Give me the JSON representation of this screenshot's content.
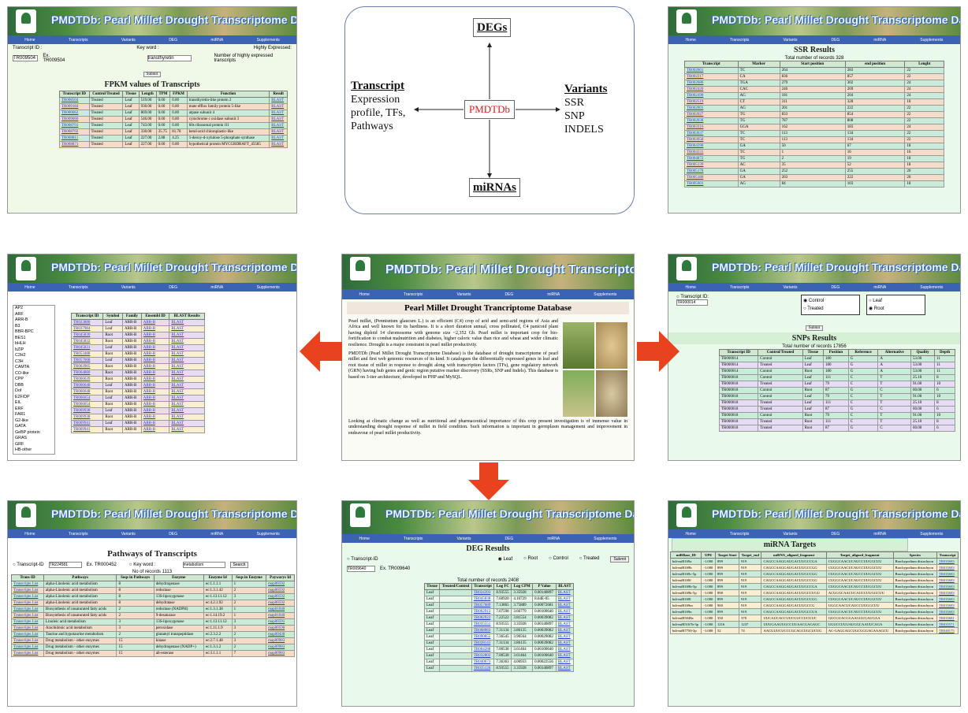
{
  "banner_title": "PMDTDb: Pearl Millet Drought Transcriptome Database",
  "nav": [
    "Home",
    "Transcripts",
    "Variants",
    "DEG",
    "miRNA",
    "Supplements"
  ],
  "diagram": {
    "center": "PMDTDb",
    "top": "DEGs",
    "bottom": "miRNAs",
    "left_title": "Transcript",
    "left_body": [
      "Expression",
      "profile, TFs,",
      "Pathways"
    ],
    "right_title": "Variants",
    "right_body": [
      "SSR",
      "SNP",
      "INDELS"
    ]
  },
  "fpkm": {
    "heading": "FPKM values of Transcripts",
    "form": {
      "tid_label": "Transcript ID :",
      "tid_value": "TR009504",
      "tid_example": "Ex. TR009504",
      "kw_label": "Key word :",
      "kw_value": "transthyretin",
      "hi_label": "Highly Expressed:",
      "submit": "Submit",
      "hi_note": "Number of highly expressed transcripts"
    },
    "headers": [
      "Transcript ID",
      "Control/Treated",
      "Tissue",
      "Length",
      "TPM",
      "FPKM",
      "Function",
      "Result"
    ],
    "rows": [
      [
        "TR008504",
        "Treated",
        "Leaf",
        "519.00",
        "0.00",
        "0.00",
        "transthyretin-like protein 2",
        "BLAST"
      ],
      [
        "TR009184",
        "Treated",
        "Leaf",
        "930.00",
        "0.00",
        "0.00",
        "mate efflux family protein 5-like",
        "BLAST"
      ],
      [
        "TR000662",
        "Treated",
        "Leaf",
        "869.00",
        "0.00",
        "0.00",
        "atpase subunit 4",
        "BLAST"
      ],
      [
        "TR009660",
        "Treated",
        "Leaf",
        "546.00",
        "0.00",
        "0.00",
        "cytochrome c oxidase subunit 3",
        "BLAST"
      ],
      [
        "TR008701",
        "Treated",
        "Leaf",
        "743.00",
        "0.00",
        "0.00",
        "60s ribosomal protein l11",
        "BLAST"
      ],
      [
        "TR008702",
        "Treated",
        "Leaf",
        "330.00",
        "35.75",
        "81.78",
        "ketol-acid chloroplastic-like",
        "BLAST"
      ],
      [
        "TR008811",
        "Treated",
        "Leaf",
        "227.00",
        "2.88",
        "4.25",
        "1-deoxy-d-xylulose 5-phosphate synthase",
        "BLAST"
      ],
      [
        "TR008871",
        "Treated",
        "Leaf",
        "227.00",
        "0.00",
        "0.00",
        "hypothetical protein MYCGRDRAFT_45585",
        "BLAST"
      ]
    ]
  },
  "ssr": {
    "heading": "SSR Results",
    "total": "Total number of records 328",
    "headers": [
      "Transcript",
      "Marker",
      "Start position",
      "end position",
      "Lenght"
    ],
    "rows": [
      [
        "TR002601",
        "TC",
        "264",
        "283",
        "22"
      ],
      [
        "TR002217",
        "CA",
        "836",
        "857",
        "22"
      ],
      [
        "TR002686",
        "TGA",
        "279",
        "302",
        "24"
      ],
      [
        "TR002420",
        "CAC",
        "246",
        "269",
        "24"
      ],
      [
        "TR002490",
        "AG",
        "181",
        "204",
        "24"
      ],
      [
        "TR002519",
        "CT",
        "311",
        "328",
        "18"
      ],
      [
        "TR002001",
        "AG",
        "201",
        "222",
        "22"
      ],
      [
        "TR002027",
        "TG",
        "833",
        "854",
        "22"
      ],
      [
        "TR002038",
        "TG",
        "787",
        "808",
        "22"
      ],
      [
        "TR003316",
        "GGA",
        "162",
        "183",
        "24"
      ],
      [
        "TR003637",
        "TC",
        "113",
        "134",
        "22"
      ],
      [
        "TR003658",
        "TC",
        "113",
        "134",
        "22"
      ],
      [
        "TR004390",
        "GA",
        "50",
        "67",
        "18"
      ],
      [
        "TR004331",
        "TC",
        "1",
        "16",
        "16"
      ],
      [
        "TR004872",
        "TG",
        "2",
        "19",
        "18"
      ],
      [
        "TR005139",
        "AC",
        "35",
        "52",
        "18"
      ],
      [
        "TR005178",
        "GA",
        "252",
        "255",
        "20"
      ],
      [
        "TR005180",
        "GA",
        "203",
        "222",
        "20"
      ],
      [
        "TR005601",
        "AG",
        "84",
        "103",
        "18"
      ]
    ]
  },
  "tf": {
    "list": [
      "AP2",
      "ARF",
      "ARR-B",
      "B3",
      "BBR-BPC",
      "BES1",
      "bHLH",
      "bZIP",
      "C2H2",
      "C3H",
      "CAMTA",
      "CO-like",
      "CPP",
      "DBB",
      "Dof",
      "E2F/DP",
      "EIL",
      "ERF",
      "FAR1",
      "G2-like",
      "GATA",
      "GeBP protein",
      "GRAS",
      "GRF",
      "HB-other"
    ],
    "headers": [
      "Transcript ID",
      "Symbol",
      "Family",
      "Ensembl ID",
      "BLAST Results"
    ],
    "rows": [
      [
        "TR023880",
        "Leaf",
        "ARR-B",
        "ARR-B",
        "BLAST"
      ],
      [
        "TR037984",
        "Leaf",
        "ARR-B",
        "ARR-B",
        "BLAST"
      ],
      [
        "TR045830",
        "Root",
        "ARR-B",
        "ARR-B",
        "BLAST"
      ],
      [
        "TR045832",
        "Root",
        "ARR-B",
        "ARR-B",
        "BLAST"
      ],
      [
        "TR045831",
        "Leaf",
        "ARR-B",
        "ARR-B",
        "BLAST"
      ],
      [
        "TR053488",
        "Root",
        "ARR-B",
        "ARR-B",
        "BLAST"
      ],
      [
        "TR057668",
        "Leaf",
        "ARR-B",
        "ARR-B",
        "BLAST"
      ],
      [
        "TR063905",
        "Root",
        "ARR-B",
        "ARR-B",
        "BLAST"
      ],
      [
        "TR064880",
        "Root",
        "ARR-B",
        "ARR-B",
        "BLAST"
      ],
      [
        "TR066639",
        "Root",
        "ARR-B",
        "ARR-B",
        "BLAST"
      ],
      [
        "TR066648",
        "Leaf",
        "ARR-B",
        "ARR-B",
        "BLAST"
      ],
      [
        "TR066648",
        "Root",
        "ARR-B",
        "ARR-B",
        "BLAST"
      ],
      [
        "TR066654",
        "Leaf",
        "ARR-B",
        "ARR-B",
        "BLAST"
      ],
      [
        "TR066654",
        "Root",
        "ARR-B",
        "ARR-B",
        "BLAST"
      ],
      [
        "TR069938",
        "Leaf",
        "ARR-B",
        "ARR-B",
        "BLAST"
      ],
      [
        "TR069938",
        "Root",
        "ARR-B",
        "ARR-B",
        "BLAST"
      ],
      [
        "TR069941",
        "Leaf",
        "ARR-B",
        "ARR-B",
        "BLAST"
      ],
      [
        "TR069941",
        "Root",
        "ARR-B",
        "ARR-B",
        "BLAST"
      ]
    ]
  },
  "home": {
    "heading": "Pearl Millet Drought Trancriptome Database",
    "p1": "Pearl millet, (Pennisetum glaucum L.) is an efficient (C4) crop of arid and semi-arid regions of Asia and Africa and well known for its hardiness. It is a short duration annual, cross pollinated, C4 panicoid plant having diploid 14 chromosome with genome size ~2,352 Gb. Pearl millet is important crop for bio-fortification to combat malnutrition and diabetes, higher caloric value than rice and wheat and wider climatic resilience. Drought is a major constraint in pearl millet productivity.",
    "p2": "PMDTDb (Pearl Millet Drought Transcriptome Database) is the database of drought transcriptome of pearl millet and first web genomic resources of its kind. It catalogues the differentially expressed genes in leaf and root tissue of millet in response to drought along with transcription factors (TFs), gene regulatory network (GRN) having hub genes and genic region putative marker discovery (SSRs, SNP and Indels). This database is based on 3-tier architecture, developed in PHP and MySQL.",
    "p3": "Looking at climatic change as well as nutritional and pharmaceutical importance of this crop present investigation is of immense value in understanding drought response of millet in field condition. Such information is important in germplasm management and improvement in endeavour of pearl millet productivity."
  },
  "snp": {
    "heading": "SNPs Results",
    "tid_label": "Transcript ID:",
    "tid_value": "TR000014",
    "opts": [
      "Control",
      "Treated",
      "Leaf",
      "Root"
    ],
    "submit": "Submit",
    "total": "Total number of records 17856",
    "headers": [
      "Transcript ID",
      "Control/Treated",
      "Tissue",
      "Position",
      "Reference",
      "Alternative",
      "Quality",
      "Depth"
    ],
    "rows": [
      [
        "TR000014",
        "Control",
        "Leaf",
        "180",
        "G",
        "A",
        "53.00",
        "11"
      ],
      [
        "TR000014",
        "Treated",
        "Leaf",
        "180",
        "G",
        "A",
        "53.00",
        "11"
      ],
      [
        "TR000014",
        "Control",
        "Root",
        "180",
        "G",
        "A",
        "53.00",
        "11"
      ],
      [
        "TR000018",
        "Control",
        "Leaf",
        "111",
        "C",
        "T",
        "25.10",
        "8"
      ],
      [
        "TR000018",
        "Treated",
        "Leaf",
        "79",
        "C",
        "T",
        "91.00",
        "10"
      ],
      [
        "TR000018",
        "Control",
        "Root",
        "87",
        "G",
        "C",
        "60.00",
        "6"
      ],
      [
        "TR000018",
        "Control",
        "Leaf",
        "79",
        "C",
        "T",
        "91.00",
        "10"
      ],
      [
        "TR000018",
        "Treated",
        "Leaf",
        "111",
        "C",
        "T",
        "25.10",
        "8"
      ],
      [
        "TR000018",
        "Treated",
        "Leaf",
        "87",
        "G",
        "C",
        "60.00",
        "6"
      ],
      [
        "TR000018",
        "Control",
        "Root",
        "79",
        "C",
        "T",
        "91.00",
        "10"
      ],
      [
        "TR000018",
        "Treated",
        "Root",
        "111",
        "C",
        "T",
        "25.10",
        "8"
      ],
      [
        "TR000018",
        "Treated",
        "Root",
        "87",
        "G",
        "C",
        "60.00",
        "6"
      ]
    ]
  },
  "pathways": {
    "heading": "Pathways of Transcripts",
    "tid_label": "Transcript-ID",
    "tid_value": "TR224581",
    "tid_example": "Ex. TR000452",
    "kw_label": "Key word :",
    "kw_value": "metabolism",
    "search": "Search",
    "total": "No of records 1113",
    "headers": [
      "Trans ID",
      "Pathways",
      "Seqs in Pathways",
      "Enzyme",
      "Enzyme Id",
      "Seqs in Enzyme",
      "Paywarys Id"
    ],
    "rows": [
      [
        "Transcripts List",
        "alpha-Linolenic acid metabolism",
        "8",
        "dehydrogenase",
        "ec:1.1.1.1",
        "1",
        "map00592"
      ],
      [
        "Transcripts List",
        "alpha-Linolenic acid metabolism",
        "8",
        "reductase",
        "ec:1.3.1.42",
        "2",
        "map00592"
      ],
      [
        "Transcripts List",
        "alpha-Linolenic acid metabolism",
        "8",
        "13S-lipoxygenase",
        "ec:1.13.11.12",
        "3",
        "map00592"
      ],
      [
        "Transcripts List",
        "alpha-Linolenic acid metabolism",
        "8",
        "dehydratase",
        "ec:4.2.1.92",
        "2",
        "map00592"
      ],
      [
        "Transcripts List",
        "Biosynthesis of unsaturated fatty acids",
        "2",
        "reductase (NADPH)",
        "ec:1.3.1.38",
        "1",
        "map01040"
      ],
      [
        "Transcripts List",
        "Biosynthesis of unsaturated fatty acids",
        "2",
        "9-desaturase",
        "ec:1.14.19.2",
        "1",
        "map01040"
      ],
      [
        "Transcripts List",
        "Linoleic acid metabolism",
        "3",
        "13S-lipoxygenase",
        "ec:1.13.11.12",
        "3",
        "map00591"
      ],
      [
        "Transcripts List",
        "Arachidonic acid metabolism",
        "3",
        "peroxidase",
        "ec:1.11.1.9",
        "3",
        "map00590"
      ],
      [
        "Transcripts List",
        "Taurine and hypotaurine metabolism",
        "2",
        "glutamyl transpeptidase",
        "ec:2.3.2.2",
        "2",
        "map00430"
      ],
      [
        "Transcripts List",
        "Drug metabolism - other enzymes",
        "15",
        "kinase",
        "ec:2.7.1.48",
        "3",
        "map00983"
      ],
      [
        "Transcripts List",
        "Drug metabolism - other enzymes",
        "15",
        "dehydrogenase (NADP+)",
        "ec:1.3.1.2",
        "2",
        "map00983"
      ],
      [
        "Transcripts List",
        "Drug metabolism - other enzymes",
        "15",
        "ali-esterase",
        "ec:3.1.1.1",
        "7",
        "map00983"
      ]
    ]
  },
  "deg": {
    "heading": "DEG Results",
    "tid_label": "Transcript-ID",
    "tid_value": "TR009640",
    "tid_example": "Ex. TR009640",
    "opts": [
      "Leaf",
      "Root",
      "Control",
      "Treated"
    ],
    "submit": "Submit",
    "total": "Total number of records 2408",
    "headers": [
      "Tissue",
      "Treated/Control",
      "Transcript",
      "Log FC",
      "Log CPM",
      "P Value",
      "BLAST"
    ],
    "rows": [
      [
        "Leaf",
        "",
        "TR024393",
        "8.93555",
        "3.35928",
        "0.00140897",
        "BLAST"
      ],
      [
        "Leaf",
        "",
        "TR045838",
        "7.60920",
        "4.10729",
        "8.64E-05",
        "BLAST"
      ],
      [
        "Leaf",
        "",
        "TR057689",
        "7.13865",
        "3.75889",
        "0.00072681",
        "BLAST"
      ],
      [
        "Leaf",
        "",
        "TR062913",
        "7.07598",
        "3.66779",
        "0.00100640",
        "BLAST"
      ],
      [
        "Leaf",
        "",
        "TR062922",
        "7.22522",
        "3.81554",
        "0.00039082",
        "BLAST"
      ],
      [
        "Leaf",
        "",
        "TR035551",
        "8.93555",
        "3.35928",
        "0.00140897",
        "BLAST"
      ],
      [
        "Leaf",
        "",
        "TR068083",
        "7.31134",
        "3.86135",
        "0.00039082",
        "BLAST"
      ],
      [
        "Leaf",
        "",
        "TR090855",
        "7.36545",
        "3.90564",
        "0.00029082",
        "BLAST"
      ],
      [
        "Leaf",
        "",
        "TR028143",
        "7.31134",
        "3.86135",
        "0.00039082",
        "BLAST"
      ],
      [
        "Leaf",
        "",
        "TR064288",
        "7.00538",
        "3.61464",
        "0.00100640",
        "BLAST"
      ],
      [
        "Leaf",
        "",
        "TR032803",
        "7.00538",
        "3.61464",
        "0.00100640",
        "BLAST"
      ],
      [
        "Leaf",
        "",
        "TR040673",
        "7.36363",
        "4.06933",
        "0.00022556",
        "BLAST"
      ],
      [
        "Leaf",
        "",
        "TR035126",
        "8.93555",
        "3.35928",
        "0.00140897",
        "BLAST"
      ]
    ]
  },
  "mirna": {
    "heading": "miRNA Targets",
    "headers": [
      "miRBase_ID",
      "UPE",
      "Target Start",
      "Target_end",
      "miRNA_aligned_fragment",
      "Target_aligned_fragment",
      "Species",
      "Transcript"
    ],
    "rows": [
      [
        "bdi-miR169a",
        "-1.000",
        "899",
        "919",
        "CAGCCAAGGAUGACUUGCCGA",
        "CUGGCAACUCAUCCUUGGCUU",
        "Brachypodium distachyon",
        "TR035683"
      ],
      [
        "bdi-miR169b",
        "-1.000",
        "899",
        "919",
        "CAGCCAAGGAUGACUUGCCGG",
        "CUGGCAACUCAUCCUUGGCUU",
        "Brachypodium distachyon",
        "TR035683"
      ],
      [
        "bdi-miR169c-5p",
        "-1.000",
        "899",
        "919",
        "CAGCCAAGGAUGACUUGCCGG",
        "CUGGCAACUCAUCCUUGGCUU",
        "Brachypodium distachyon",
        "TR035683"
      ],
      [
        "bdi-miR169f",
        "-1.000",
        "899",
        "919",
        "CAGCCAAGGAUGACUUGCCGG",
        "CUGGCAACUCAUCCUUGGCUU",
        "Brachypodium distachyon",
        "TR035683"
      ],
      [
        "bdi-miR169h-5p",
        "-1.000",
        "899",
        "919",
        "CAGCCAAGGAUGACUUGCCGA",
        "CUGGCAACUCAUCCUUGGCUU",
        "Brachypodium distachyon",
        "TR035683"
      ],
      [
        "bdi-miR169k-5p",
        "-1.000",
        "898",
        "919",
        "CAGCCAAGGAUGACUUGCCUGU",
        "ACUGGCAACUCAUCCUUGGCUU",
        "Brachypodium distachyon",
        "TR035683"
      ],
      [
        "bdi-miR169l",
        "-1.000",
        "899",
        "919",
        "CAGCCAAGGAUGACUUGCCGG",
        "CUGGCAACUCAUCCUUGGCUU",
        "Brachypodium distachyon",
        "TR035683"
      ],
      [
        "bdi-miR169m",
        "-1.000",
        "900",
        "919",
        "CAGCCAAGGAUGACUUGCCG",
        "UGGCAACUCAUCCUUGGCUU",
        "Brachypodium distachyon",
        "TR035683"
      ],
      [
        "bdi-miR169n",
        "-1.000",
        "899",
        "919",
        "CAGCCAAGGAUGACUUGCCUA",
        "CUGGCAACUCAUCCUUGGCUU",
        "Brachypodium distachyon",
        "TR035683"
      ],
      [
        "bdi-miR5048a",
        "-1.000",
        "350",
        "370",
        "UUCAUCACCUUCGUCCUCUUC",
        "GUCGUACGGAAGGUGAUGAA",
        "Brachypodium distachyon",
        "TR035681"
      ],
      [
        "bdi-miR5167b-3p",
        "-1.000",
        "1216",
        "1237",
        "UUUGAAUUGCCUUAACGAGAGC",
        "UGUCCUUUAUGGCAAUUCAGA",
        "Brachypodium distachyon",
        "TR035571"
      ],
      [
        "bdi-miR7750-3p",
        "-1.000",
        "52",
        "74",
        "AACUUUCUCCCGCAGCUGCUCUG",
        "AC-GAGCAGCUGCGGGAGAAAGCU",
        "Brachypodium distachyon",
        "TR048175"
      ]
    ]
  }
}
